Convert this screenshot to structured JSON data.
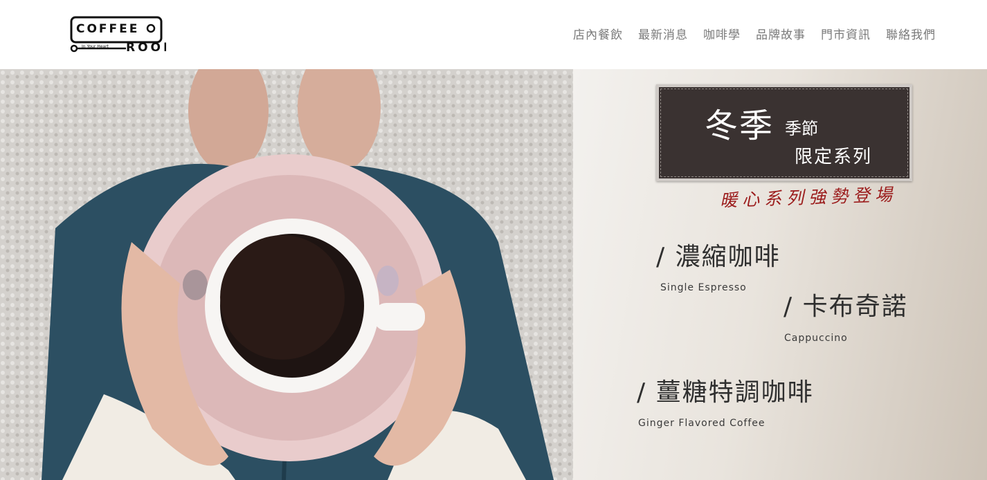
{
  "brand": {
    "logo_top": "COFFEE",
    "logo_bottom": "ROOM",
    "logo_tagline": "In Your Heart"
  },
  "nav": {
    "items": [
      "店內餐飲",
      "最新消息",
      "咖啡學",
      "品牌故事",
      "門市資訊",
      "聯絡我們"
    ]
  },
  "promo": {
    "board_big": "冬季",
    "board_small_1": "季節",
    "board_small_2": "限定系列",
    "tagline": "暖心系列強勢登場",
    "items": [
      {
        "zh": "/ 濃縮咖啡",
        "en": "Single Espresso"
      },
      {
        "zh": "/ 卡布奇諾",
        "en": "Cappuccino"
      },
      {
        "zh": "/ 薑糖特調咖啡",
        "en": "Ginger Flavored Coffee"
      }
    ]
  }
}
